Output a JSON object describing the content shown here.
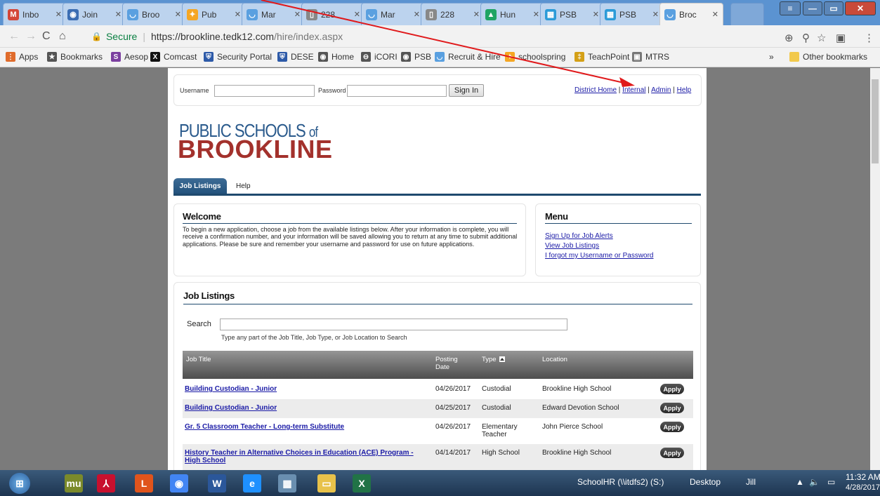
{
  "browser": {
    "tabs": [
      {
        "label": "Inbo",
        "icon": "gmail-icon",
        "color": "#d44638",
        "glyph": "M"
      },
      {
        "label": "Join",
        "icon": "globe-icon",
        "color": "#3b6db3",
        "glyph": "◉"
      },
      {
        "label": "Broo",
        "icon": "recruit-icon",
        "color": "#5aa0e0",
        "glyph": "◡"
      },
      {
        "label": "Pub",
        "icon": "schoolspring-icon",
        "color": "#f5a623",
        "glyph": "✦"
      },
      {
        "label": "Mar",
        "icon": "recruit-icon",
        "color": "#5aa0e0",
        "glyph": "◡"
      },
      {
        "label": "228",
        "icon": "document-icon",
        "color": "#888888",
        "glyph": "▯"
      },
      {
        "label": "Mar",
        "icon": "recruit-icon",
        "color": "#5aa0e0",
        "glyph": "◡"
      },
      {
        "label": "228",
        "icon": "document-icon",
        "color": "#888888",
        "glyph": "▯"
      },
      {
        "label": "Hun",
        "icon": "drive-icon",
        "color": "#1fa463",
        "glyph": "▲"
      },
      {
        "label": "PSB",
        "icon": "table-icon",
        "color": "#2b9bd8",
        "glyph": "▦"
      },
      {
        "label": "PSB",
        "icon": "table-icon",
        "color": "#2b9bd8",
        "glyph": "▦"
      },
      {
        "label": "Broc",
        "icon": "recruit-icon",
        "color": "#5aa0e0",
        "glyph": "◡"
      }
    ],
    "url_secure": "Secure",
    "url_host": "https://brookline.tedk12.com",
    "url_path": "/hire/index.aspx",
    "bookmarks": [
      {
        "label": "Apps",
        "icon": "apps-icon",
        "color": "#e06c2c",
        "glyph": "⋮"
      },
      {
        "label": "Bookmarks",
        "icon": "star-icon",
        "color": "#555555",
        "glyph": "★"
      },
      {
        "label": "Aesop",
        "icon": "aesop-icon",
        "color": "#7b3fa0",
        "glyph": "S"
      },
      {
        "label": "Comcast",
        "icon": "comcast-icon",
        "color": "#111111",
        "glyph": "X"
      },
      {
        "label": "Security Portal",
        "icon": "shield-icon",
        "color": "#2d5aa8",
        "glyph": "⛨"
      },
      {
        "label": "DESE",
        "icon": "shield-icon",
        "color": "#2d5aa8",
        "glyph": "⛨"
      },
      {
        "label": "Home",
        "icon": "home-icon",
        "color": "#555555",
        "glyph": "◉"
      },
      {
        "label": "iCORI",
        "icon": "globe-icon",
        "color": "#555555",
        "glyph": "⊖"
      },
      {
        "label": "PSB",
        "icon": "globe-icon",
        "color": "#555555",
        "glyph": "◉"
      },
      {
        "label": "Recruit & Hire",
        "icon": "recruit-icon",
        "color": "#5aa0e0",
        "glyph": "◡"
      },
      {
        "label": "schoolspring",
        "icon": "schoolspring-icon",
        "color": "#f5a623",
        "glyph": "✦"
      },
      {
        "label": "TeachPoint",
        "icon": "teachpoint-icon",
        "color": "#d4a017",
        "glyph": "‡"
      },
      {
        "label": "MTRS",
        "icon": "mtrs-icon",
        "color": "#777777",
        "glyph": "▣"
      }
    ],
    "bookmarks_more": "»",
    "other_bookmarks": "Other bookmarks"
  },
  "login": {
    "username_label": "Username",
    "password_label": "Password",
    "signin_label": "Sign In",
    "links": [
      "District Home",
      "Internal",
      "Admin",
      "Help"
    ]
  },
  "logo": {
    "line1": "PUBLIC SCHOOLS",
    "line1_of": "of",
    "line2": "BROOKLINE"
  },
  "nav": {
    "active_tab": "Job Listings",
    "help_tab": "Help"
  },
  "welcome": {
    "title": "Welcome",
    "text": "To begin a new application, choose a job from the available listings below. After your information is complete, you will receive a confirmation number, and your information will be saved allowing you to return at any time to submit additional applications. Please be sure and remember your username and password for use on future applications."
  },
  "menu": {
    "title": "Menu",
    "links": [
      "Sign Up for Job Alerts",
      "View Job Listings",
      "I forgot my Username or Password"
    ]
  },
  "listings": {
    "title": "Job Listings",
    "search_label": "Search",
    "search_value": "",
    "search_help": "Type any part of the Job Title, Job Type, or Job Location to Search",
    "columns": [
      "Job Title",
      "Posting Date",
      "Type",
      "Location"
    ],
    "apply_label": "Apply",
    "rows": [
      {
        "title": "Building Custodian - Junior",
        "date": "04/26/2017",
        "type": "Custodial",
        "location": "Brookline High School"
      },
      {
        "title": "Building Custodian - Junior",
        "date": "04/25/2017",
        "type": "Custodial",
        "location": "Edward Devotion School"
      },
      {
        "title": "Gr. 5 Classroom Teacher - Long-term Substitute",
        "date": "04/26/2017",
        "type": "Elementary Teacher",
        "location": "John Pierce School"
      },
      {
        "title": "History Teacher in Alternative Choices in Education (ACE) Program - High School",
        "date": "04/14/2017",
        "type": "High School",
        "location": "Brookline High School"
      }
    ]
  },
  "taskbar": {
    "apps": [
      {
        "name": "mu",
        "color": "#7b8a2a"
      },
      {
        "name": "acrobat",
        "color": "#c8102e"
      },
      {
        "name": "L",
        "color": "#e0541c"
      },
      {
        "name": "chrome",
        "color": "#4285f4"
      },
      {
        "name": "W",
        "color": "#2b579a"
      },
      {
        "name": "ie",
        "color": "#1e90ff"
      },
      {
        "name": "calc",
        "color": "#6a8fb0"
      },
      {
        "name": "folder",
        "color": "#e8c24a"
      },
      {
        "name": "X",
        "color": "#217346"
      }
    ],
    "schoolhr": "SchoolHR (\\\\itdfs2) (S:)",
    "desktop": "Desktop",
    "user": "Jill",
    "time": "11:32 AM",
    "date": "4/28/2017"
  },
  "colors": {
    "accent_blue": "#1f4a6e",
    "logo_red": "#a3312c",
    "link": "#1a1aa6",
    "annotation_arrow": "#e0191b"
  }
}
